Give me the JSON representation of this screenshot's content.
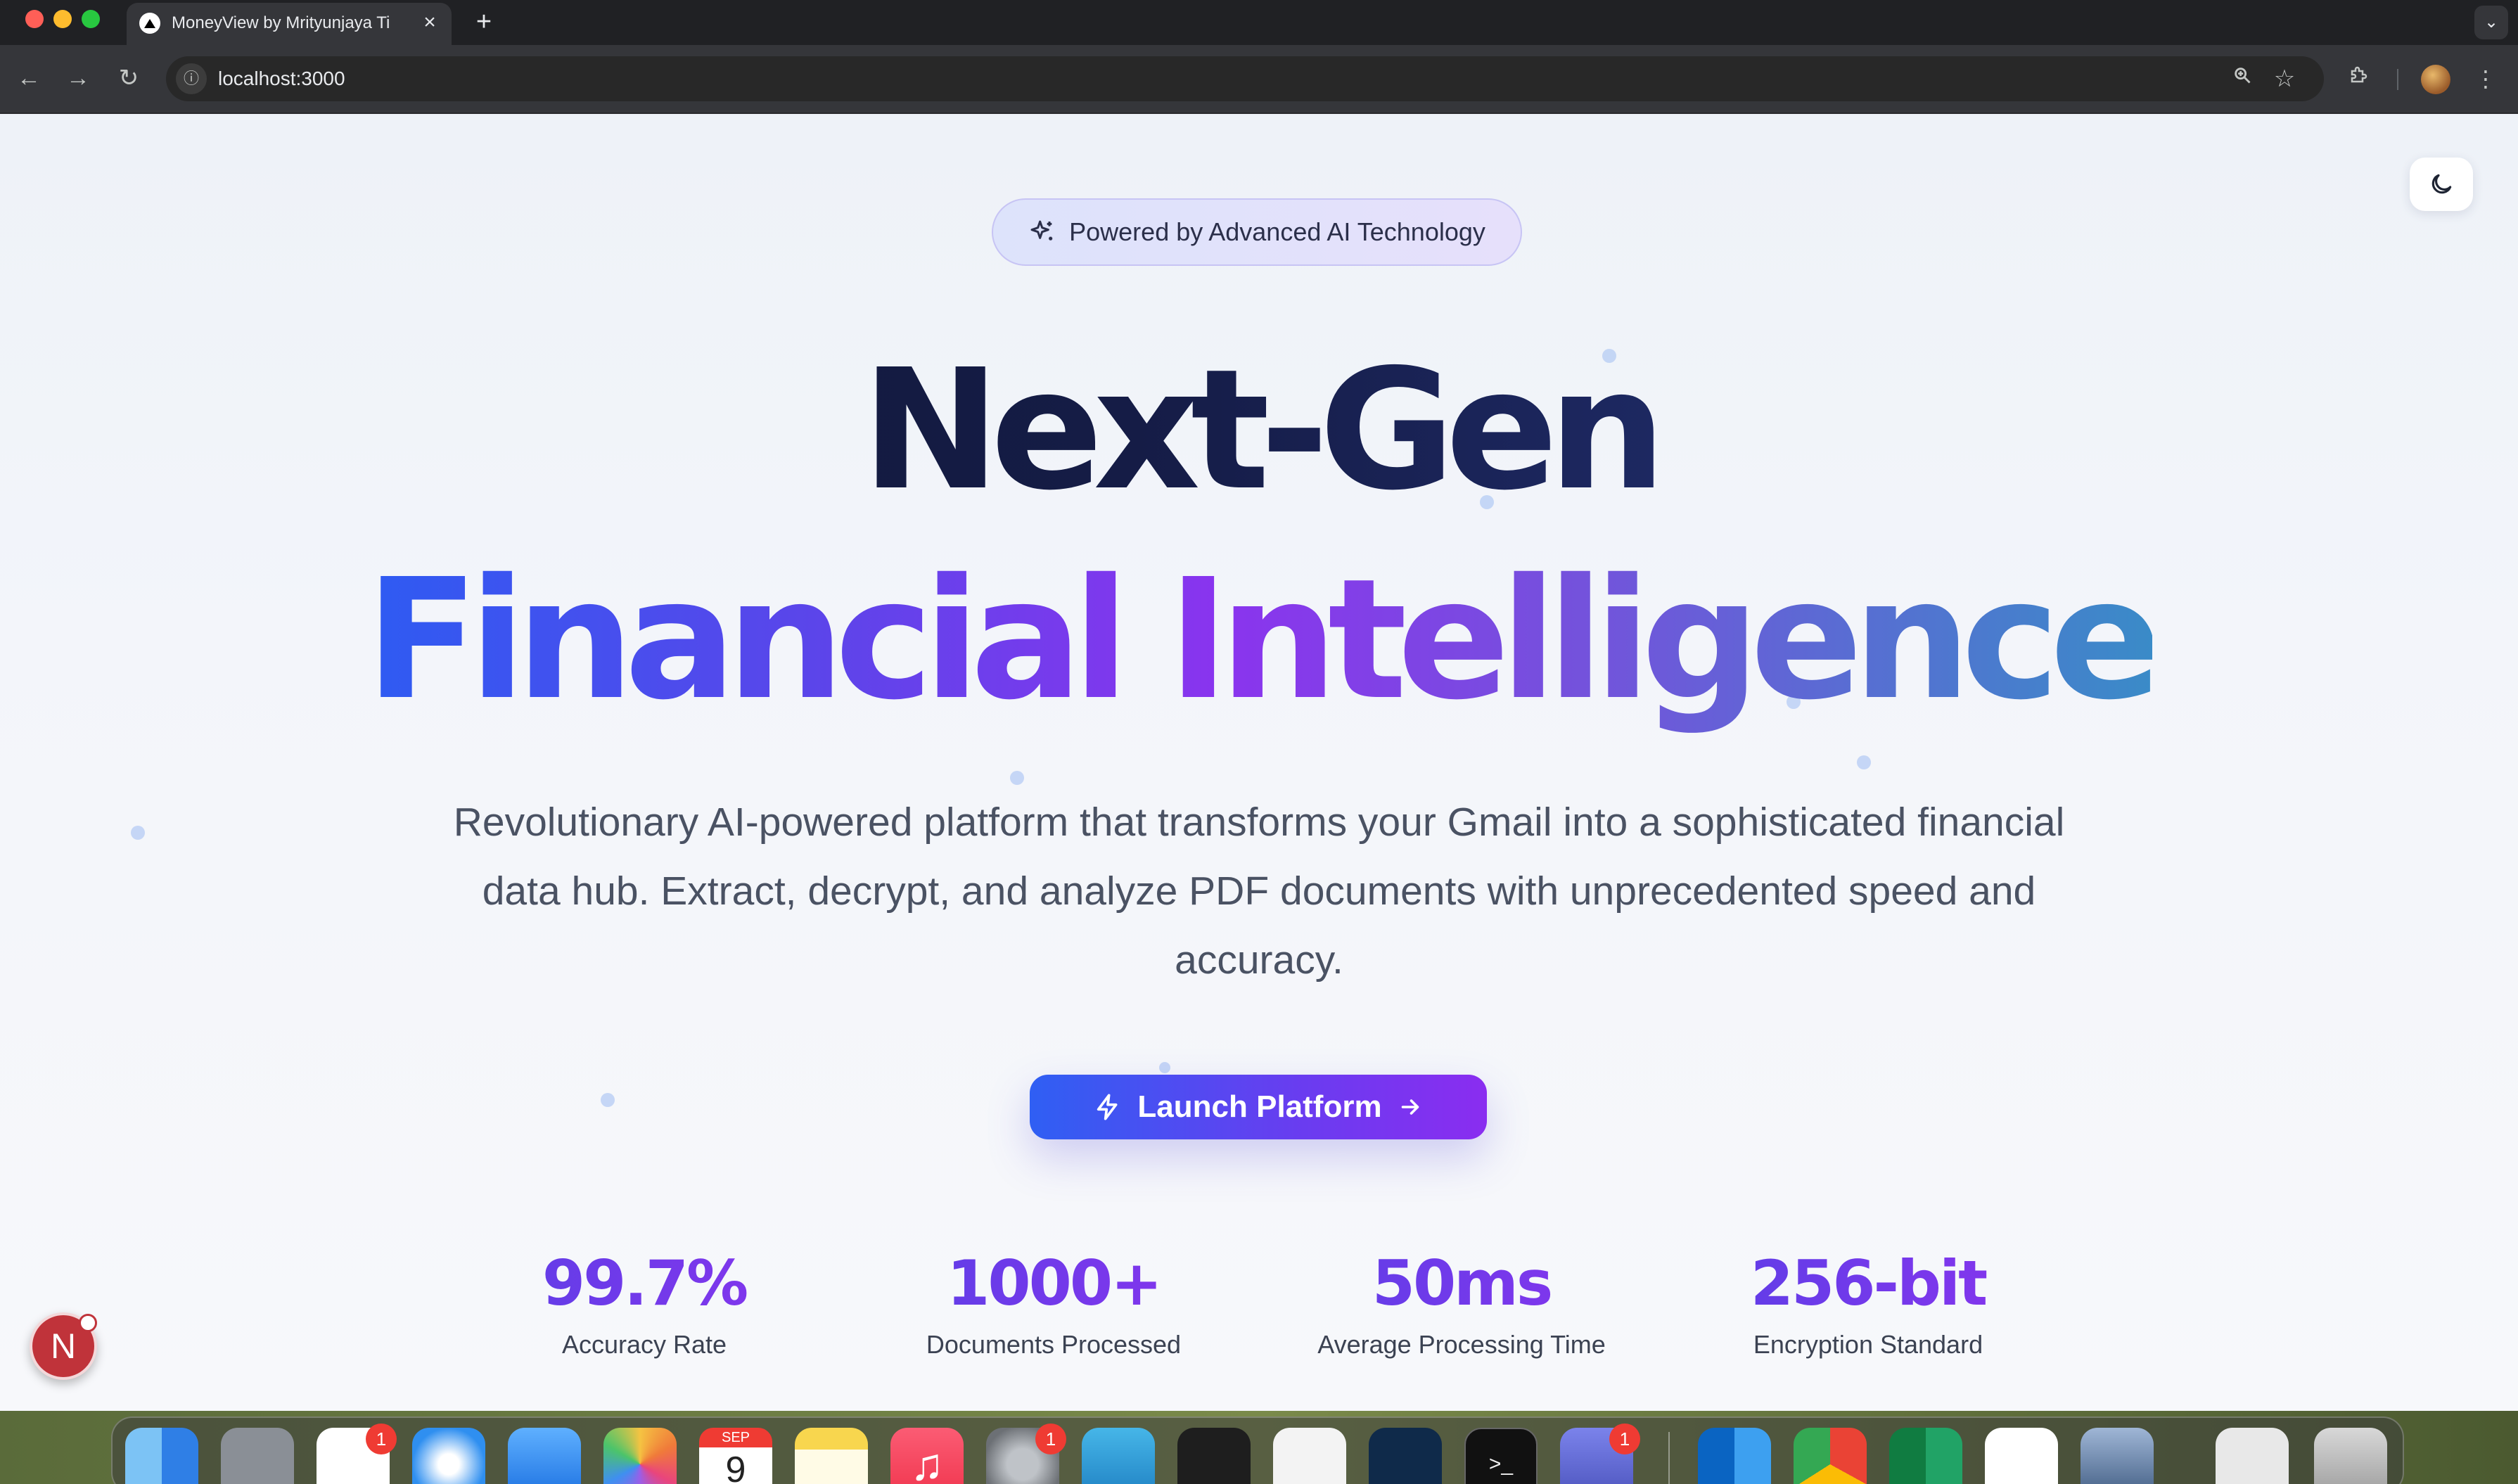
{
  "browser": {
    "tab_title": "MoneyView by Mrityunjaya Ti",
    "url": "localhost:3000"
  },
  "page": {
    "badge_text": "Powered by Advanced AI Technology",
    "hero_line1": "Next-Gen",
    "hero_line2": "Financial Intelligence",
    "subtitle": "Revolutionary AI-powered platform that transforms your Gmail into a sophisticated financial data hub. Extract, decrypt, and analyze PDF documents with unprecedented speed and accuracy.",
    "cta_label": "Launch Platform",
    "stats": [
      {
        "value": "99.7%",
        "label": "Accuracy Rate"
      },
      {
        "value": "1000+",
        "label": "Documents Processed"
      },
      {
        "value": "50ms",
        "label": "Average Processing Time"
      },
      {
        "value": "256-bit",
        "label": "Encryption Standard"
      }
    ],
    "dev_badge": "N"
  },
  "dock": {
    "calendar_month": "SEP",
    "calendar_day": "9",
    "badges": {
      "reminders": "1",
      "settings": "1",
      "teams": "1"
    }
  },
  "colors": {
    "accent_blue": "#2f5ff3",
    "accent_purple": "#8a34ee",
    "heading_navy": "#101633"
  }
}
